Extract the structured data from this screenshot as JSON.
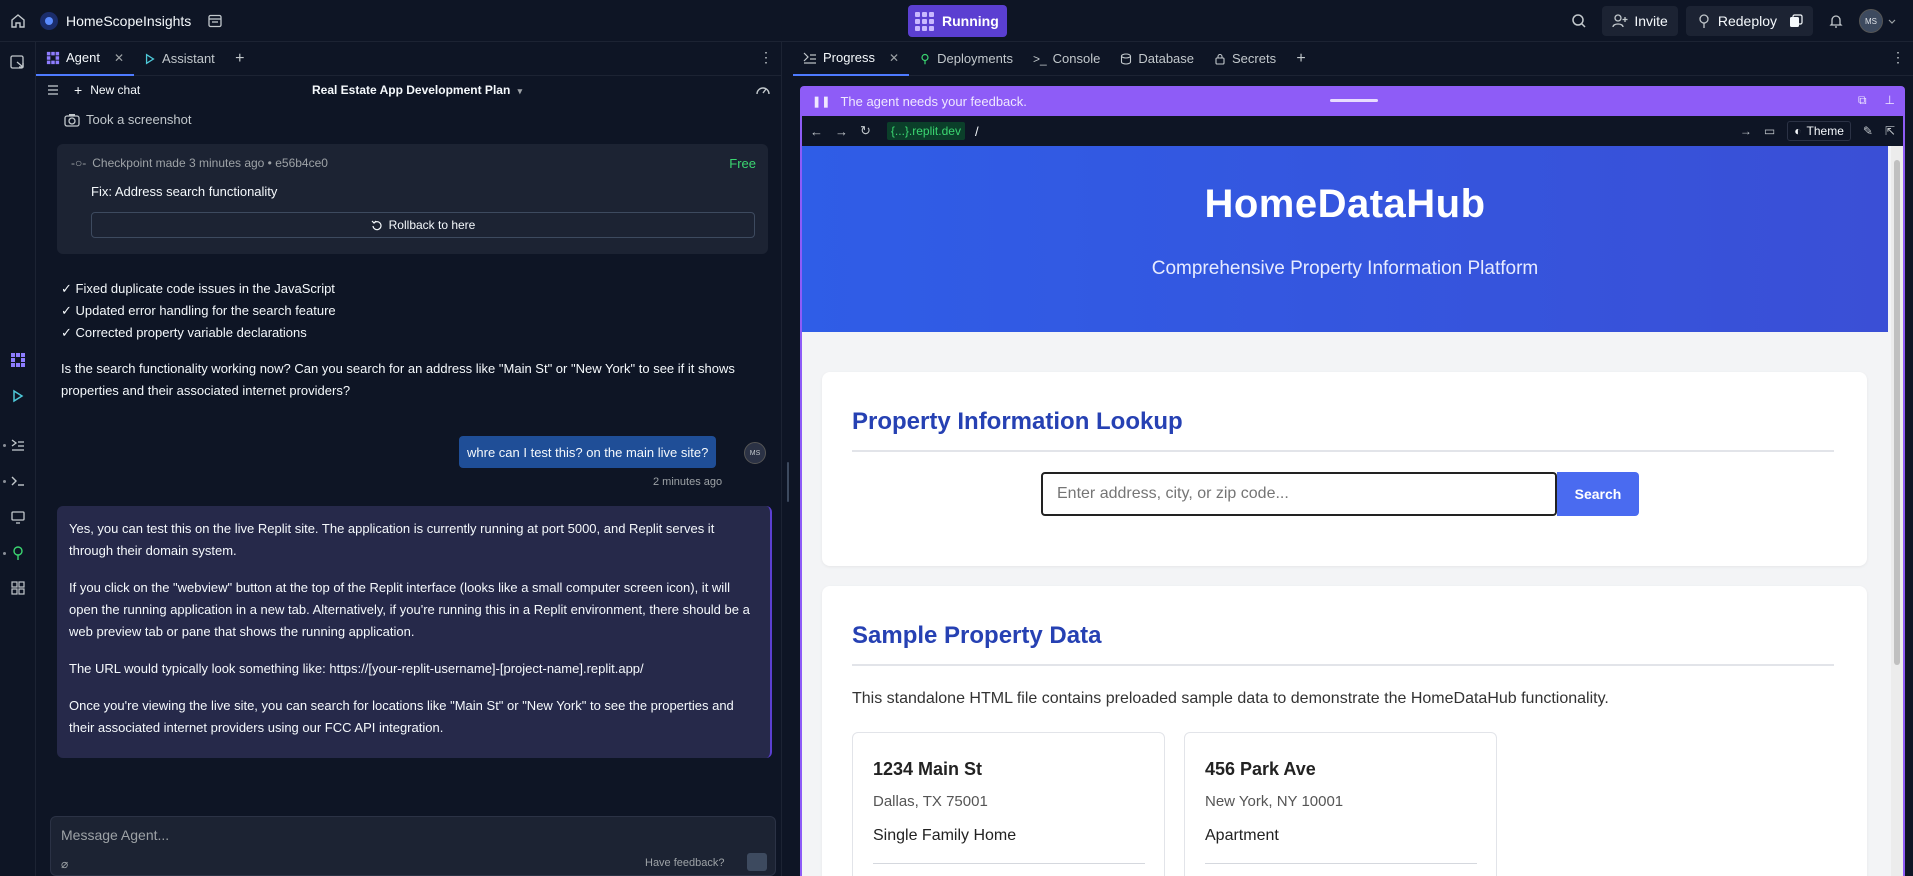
{
  "topbar": {
    "app_name": "HomeScopeInsights",
    "run_status": "Running",
    "invite_label": "Invite",
    "redeploy_label": "Redeploy",
    "user_initials": "MS"
  },
  "left_tabs": [
    {
      "label": "Agent",
      "active": true
    },
    {
      "label": "Assistant",
      "active": false
    }
  ],
  "chat_header": {
    "new_chat": "New chat",
    "title": "Real Estate App Development Plan"
  },
  "chat": {
    "screenshot_note": "Took a screenshot",
    "checkpoint": {
      "meta": "Checkpoint made 3 minutes ago • e56b4ce0",
      "badge": "Free",
      "title": "Fix: Address search functionality",
      "rollback": "Rollback to here"
    },
    "fixes": [
      "✓ Fixed duplicate code issues in the JavaScript",
      "✓ Updated error handling for the search feature",
      "✓ Corrected property variable declarations"
    ],
    "question": "Is the search functionality working now? Can you search for an address like \"Main St\" or \"New York\" to see if it shows properties and their associated internet providers?",
    "user_message": "whre can I test this? on the main live site?",
    "user_initials": "MS",
    "user_time": "2 minutes ago",
    "agent_paragraphs": [
      "Yes, you can test this on the live Replit site. The application is currently running at port 5000, and Replit serves it through their domain system.",
      "If you click on the \"webview\" button at the top of the Replit interface (looks like a small computer screen icon), it will open the running application in a new tab. Alternatively, if you're running this in a Replit environment, there should be a web preview tab or pane that shows the running application.",
      "The URL would typically look something like: https://[your-replit-username]-[project-name].replit.app/",
      "Once you're viewing the live site, you can search for locations like \"Main St\" or \"New York\" to see the properties and their associated internet providers using our FCC API integration."
    ]
  },
  "composer": {
    "placeholder": "Message Agent...",
    "feedback": "Have feedback?"
  },
  "right_tabs": [
    {
      "label": "Progress",
      "active": true
    },
    {
      "label": "Deployments",
      "active": false
    },
    {
      "label": "Console",
      "active": false
    },
    {
      "label": "Database",
      "active": false
    },
    {
      "label": "Secrets",
      "active": false
    }
  ],
  "preview": {
    "feedback_banner": "The agent needs your feedback.",
    "url_domain": "{...}.replit.dev",
    "url_path": "/",
    "theme_label": "Theme"
  },
  "site": {
    "title": "HomeDataHub",
    "subtitle": "Comprehensive Property Information Platform",
    "lookup_title": "Property Information Lookup",
    "search_placeholder": "Enter address, city, or zip code...",
    "search_button": "Search",
    "sample_title": "Sample Property Data",
    "sample_desc": "This standalone HTML file contains preloaded sample data to demonstrate the HomeDataHub functionality.",
    "properties": [
      {
        "address": "1234 Main St",
        "city": "Dallas, TX 75001",
        "type": "Single Family Home"
      },
      {
        "address": "456 Park Ave",
        "city": "New York, NY 10001",
        "type": "Apartment"
      }
    ]
  },
  "colors": {
    "accent": "#4e7bff",
    "run_button": "#5b3fd1",
    "feedback_bar": "#8e5cf7",
    "hero": "#3a4fd6",
    "free_badge": "#3bd671"
  }
}
